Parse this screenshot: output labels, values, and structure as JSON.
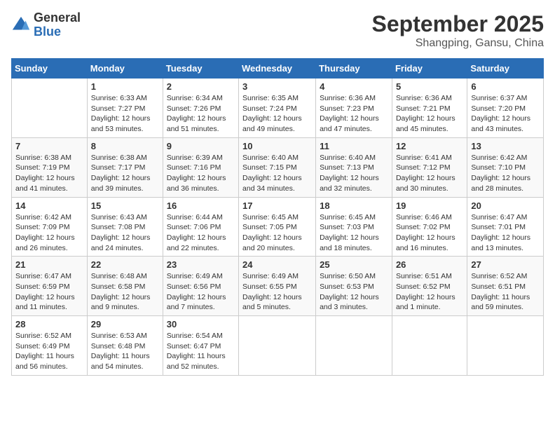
{
  "logo": {
    "general": "General",
    "blue": "Blue"
  },
  "title": "September 2025",
  "location": "Shangping, Gansu, China",
  "days_of_week": [
    "Sunday",
    "Monday",
    "Tuesday",
    "Wednesday",
    "Thursday",
    "Friday",
    "Saturday"
  ],
  "weeks": [
    [
      {
        "day": "",
        "info": ""
      },
      {
        "day": "1",
        "info": "Sunrise: 6:33 AM\nSunset: 7:27 PM\nDaylight: 12 hours and 53 minutes."
      },
      {
        "day": "2",
        "info": "Sunrise: 6:34 AM\nSunset: 7:26 PM\nDaylight: 12 hours and 51 minutes."
      },
      {
        "day": "3",
        "info": "Sunrise: 6:35 AM\nSunset: 7:24 PM\nDaylight: 12 hours and 49 minutes."
      },
      {
        "day": "4",
        "info": "Sunrise: 6:36 AM\nSunset: 7:23 PM\nDaylight: 12 hours and 47 minutes."
      },
      {
        "day": "5",
        "info": "Sunrise: 6:36 AM\nSunset: 7:21 PM\nDaylight: 12 hours and 45 minutes."
      },
      {
        "day": "6",
        "info": "Sunrise: 6:37 AM\nSunset: 7:20 PM\nDaylight: 12 hours and 43 minutes."
      }
    ],
    [
      {
        "day": "7",
        "info": "Sunrise: 6:38 AM\nSunset: 7:19 PM\nDaylight: 12 hours and 41 minutes."
      },
      {
        "day": "8",
        "info": "Sunrise: 6:38 AM\nSunset: 7:17 PM\nDaylight: 12 hours and 39 minutes."
      },
      {
        "day": "9",
        "info": "Sunrise: 6:39 AM\nSunset: 7:16 PM\nDaylight: 12 hours and 36 minutes."
      },
      {
        "day": "10",
        "info": "Sunrise: 6:40 AM\nSunset: 7:15 PM\nDaylight: 12 hours and 34 minutes."
      },
      {
        "day": "11",
        "info": "Sunrise: 6:40 AM\nSunset: 7:13 PM\nDaylight: 12 hours and 32 minutes."
      },
      {
        "day": "12",
        "info": "Sunrise: 6:41 AM\nSunset: 7:12 PM\nDaylight: 12 hours and 30 minutes."
      },
      {
        "day": "13",
        "info": "Sunrise: 6:42 AM\nSunset: 7:10 PM\nDaylight: 12 hours and 28 minutes."
      }
    ],
    [
      {
        "day": "14",
        "info": "Sunrise: 6:42 AM\nSunset: 7:09 PM\nDaylight: 12 hours and 26 minutes."
      },
      {
        "day": "15",
        "info": "Sunrise: 6:43 AM\nSunset: 7:08 PM\nDaylight: 12 hours and 24 minutes."
      },
      {
        "day": "16",
        "info": "Sunrise: 6:44 AM\nSunset: 7:06 PM\nDaylight: 12 hours and 22 minutes."
      },
      {
        "day": "17",
        "info": "Sunrise: 6:45 AM\nSunset: 7:05 PM\nDaylight: 12 hours and 20 minutes."
      },
      {
        "day": "18",
        "info": "Sunrise: 6:45 AM\nSunset: 7:03 PM\nDaylight: 12 hours and 18 minutes."
      },
      {
        "day": "19",
        "info": "Sunrise: 6:46 AM\nSunset: 7:02 PM\nDaylight: 12 hours and 16 minutes."
      },
      {
        "day": "20",
        "info": "Sunrise: 6:47 AM\nSunset: 7:01 PM\nDaylight: 12 hours and 13 minutes."
      }
    ],
    [
      {
        "day": "21",
        "info": "Sunrise: 6:47 AM\nSunset: 6:59 PM\nDaylight: 12 hours and 11 minutes."
      },
      {
        "day": "22",
        "info": "Sunrise: 6:48 AM\nSunset: 6:58 PM\nDaylight: 12 hours and 9 minutes."
      },
      {
        "day": "23",
        "info": "Sunrise: 6:49 AM\nSunset: 6:56 PM\nDaylight: 12 hours and 7 minutes."
      },
      {
        "day": "24",
        "info": "Sunrise: 6:49 AM\nSunset: 6:55 PM\nDaylight: 12 hours and 5 minutes."
      },
      {
        "day": "25",
        "info": "Sunrise: 6:50 AM\nSunset: 6:53 PM\nDaylight: 12 hours and 3 minutes."
      },
      {
        "day": "26",
        "info": "Sunrise: 6:51 AM\nSunset: 6:52 PM\nDaylight: 12 hours and 1 minute."
      },
      {
        "day": "27",
        "info": "Sunrise: 6:52 AM\nSunset: 6:51 PM\nDaylight: 11 hours and 59 minutes."
      }
    ],
    [
      {
        "day": "28",
        "info": "Sunrise: 6:52 AM\nSunset: 6:49 PM\nDaylight: 11 hours and 56 minutes."
      },
      {
        "day": "29",
        "info": "Sunrise: 6:53 AM\nSunset: 6:48 PM\nDaylight: 11 hours and 54 minutes."
      },
      {
        "day": "30",
        "info": "Sunrise: 6:54 AM\nSunset: 6:47 PM\nDaylight: 11 hours and 52 minutes."
      },
      {
        "day": "",
        "info": ""
      },
      {
        "day": "",
        "info": ""
      },
      {
        "day": "",
        "info": ""
      },
      {
        "day": "",
        "info": ""
      }
    ]
  ]
}
